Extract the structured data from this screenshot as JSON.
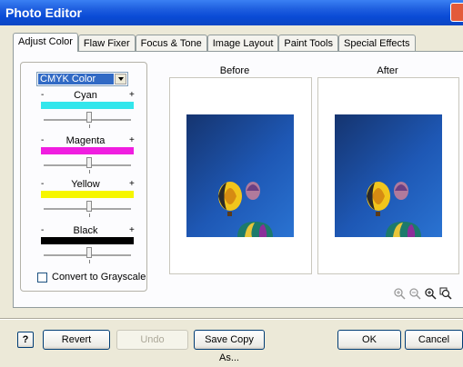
{
  "window": {
    "title": "Photo Editor"
  },
  "tabs": [
    {
      "label": "Adjust Color",
      "active": true
    },
    {
      "label": "Flaw Fixer",
      "active": false
    },
    {
      "label": "Focus & Tone",
      "active": false
    },
    {
      "label": "Image Layout",
      "active": false
    },
    {
      "label": "Paint Tools",
      "active": false
    },
    {
      "label": "Special Effects",
      "active": false
    }
  ],
  "color_panel": {
    "mode_select": {
      "value": "CMYK Color"
    },
    "minus": "-",
    "plus": "+",
    "channels": [
      {
        "name": "Cyan",
        "color": "#33e6ec",
        "level": 0.52
      },
      {
        "name": "Magenta",
        "color": "#f01ee0",
        "level": 0.52
      },
      {
        "name": "Yellow",
        "color": "#f6f600",
        "level": 0.52
      },
      {
        "name": "Black",
        "color": "#000000",
        "level": 0.52
      }
    ],
    "grayscale": {
      "label": "Convert to Grayscale",
      "checked": false
    }
  },
  "previews": {
    "before_label": "Before",
    "after_label": "After"
  },
  "zoom_icons": [
    "zoom-in-disabled-icon",
    "zoom-out-disabled-icon",
    "zoom-in-icon",
    "zoom-fit-icon"
  ],
  "buttons": {
    "help": "?",
    "revert": "Revert",
    "undo": "Undo",
    "save_copy": "Save Copy As...",
    "ok": "OK",
    "cancel": "Cancel"
  }
}
